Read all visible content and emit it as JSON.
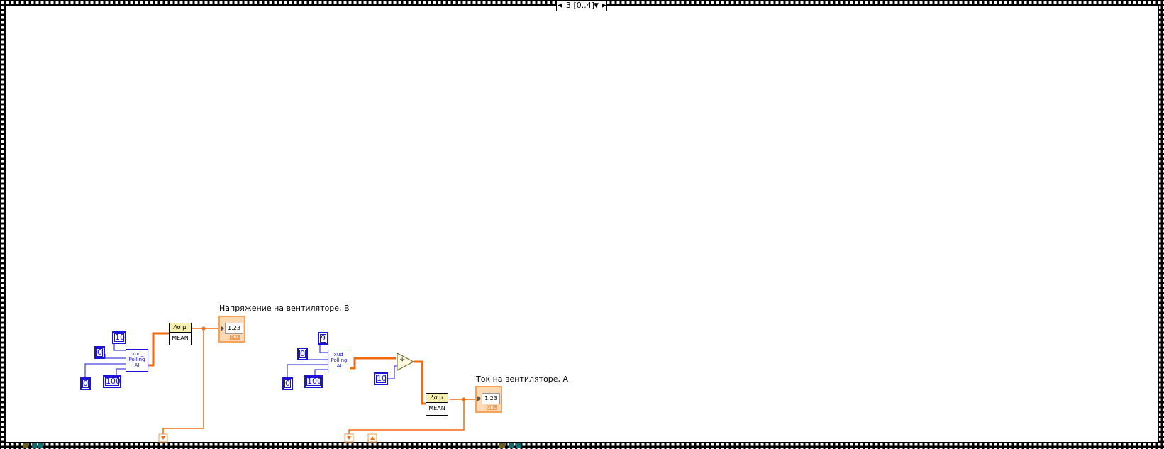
{
  "case_selector": {
    "value": "3 [0..4]"
  },
  "indicators": {
    "fan_voltage": {
      "label": "Напряжение на вентиляторе, В",
      "value": "1.23",
      "type": "DBL"
    },
    "fan_current": {
      "label": "Ток на вентиляторе, А",
      "value": "1.23",
      "type": "DBL"
    }
  },
  "block1": {
    "subvi_label": [
      "lxud_",
      "Polling",
      "AI"
    ],
    "const_10": "10",
    "const_0_a": "0",
    "const_0_b": "0",
    "const_100": "100",
    "mean": {
      "icon": "⁄\\σ μ",
      "label": "MEAN"
    }
  },
  "block2": {
    "subvi_label": [
      "lxud_",
      "Polling",
      "AI"
    ],
    "const_9": "9",
    "const_0_a": "0",
    "const_0_b": "0",
    "const_100": "100",
    "const_divisor": "10",
    "divide_symbol": "÷",
    "mean": {
      "icon": "⁄\\σ μ",
      "label": "MEAN"
    }
  },
  "colors": {
    "wire_numeric": "#f26a0f",
    "wire_int": "#1a14d6",
    "indicator_fill": "#fbd9b5",
    "frame_border": "#000000"
  }
}
